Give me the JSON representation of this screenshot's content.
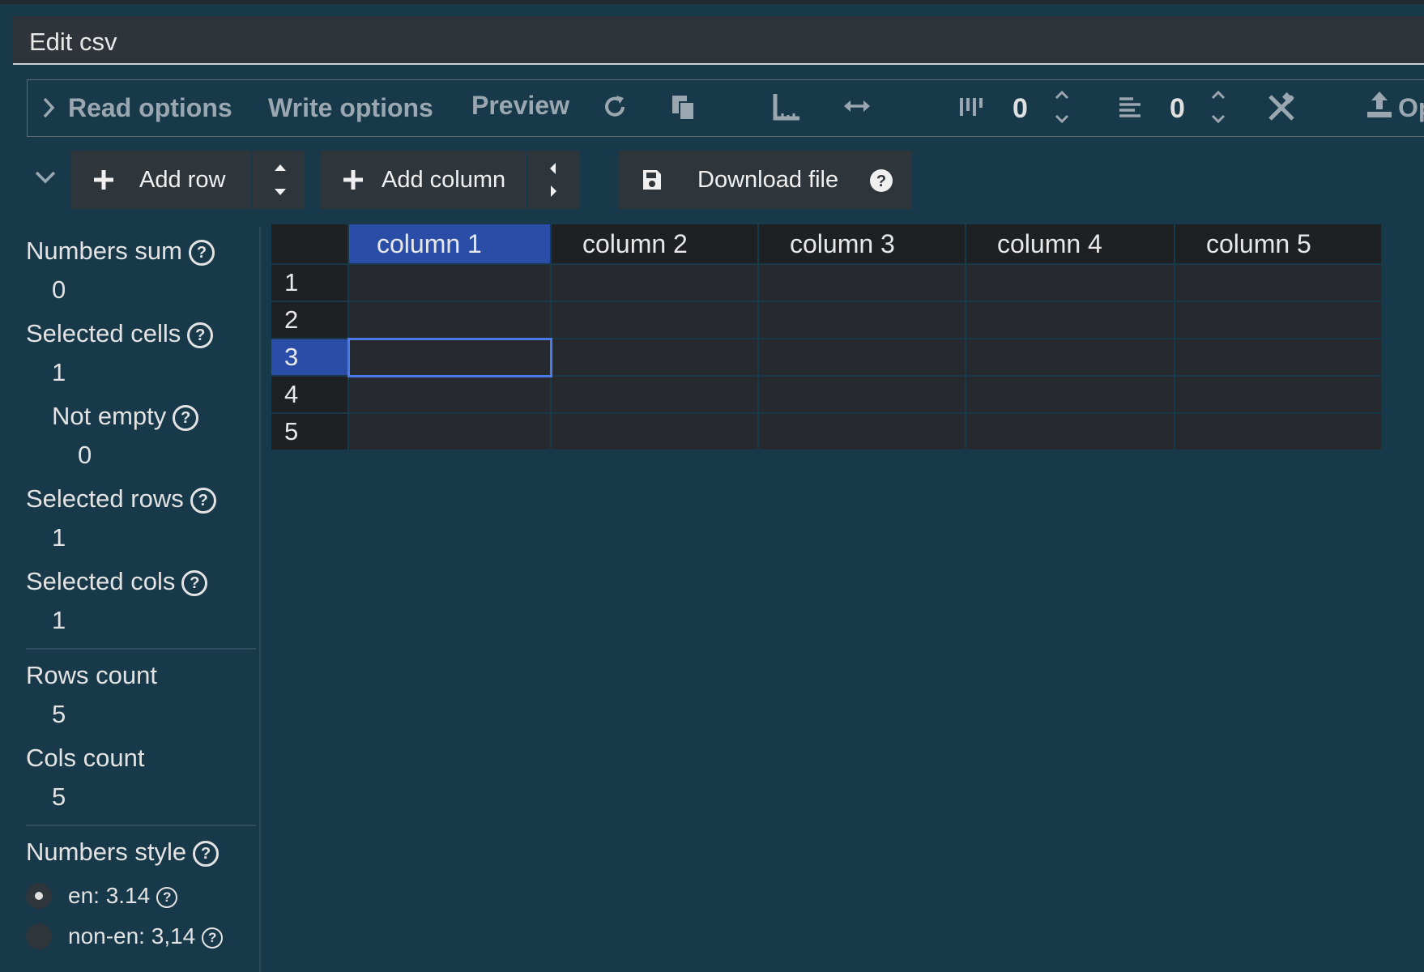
{
  "window": {
    "title": "Edit csv"
  },
  "toolbar": {
    "read_options": "Read options",
    "write_options": "Write options",
    "preview": "Preview",
    "col_margin_value": "0",
    "row_margin_value": "0",
    "open_label": "Op"
  },
  "buttons": {
    "add_row": "Add row",
    "add_column": "Add column",
    "download_file": "Download file"
  },
  "stats": {
    "numbers_sum_label": "Numbers sum",
    "numbers_sum": "0",
    "selected_cells_label": "Selected cells",
    "selected_cells": "1",
    "not_empty_label": "Not empty",
    "not_empty": "0",
    "selected_rows_label": "Selected rows",
    "selected_rows": "1",
    "selected_cols_label": "Selected cols",
    "selected_cols": "1",
    "rows_count_label": "Rows count",
    "rows_count": "5",
    "cols_count_label": "Cols count",
    "cols_count": "5",
    "numbers_style_label": "Numbers style",
    "style_en": "en: 3.14",
    "style_non_en": "non-en: 3,14"
  },
  "table": {
    "columns": [
      "column 1",
      "column 2",
      "column 3",
      "column 4",
      "column 5"
    ],
    "rows": [
      "1",
      "2",
      "3",
      "4",
      "5"
    ],
    "selected_row": 3,
    "selected_col": 1
  },
  "colors": {
    "background": "#17394a",
    "selection": "#2a4ea8",
    "cell_outline": "#4a7be8"
  }
}
